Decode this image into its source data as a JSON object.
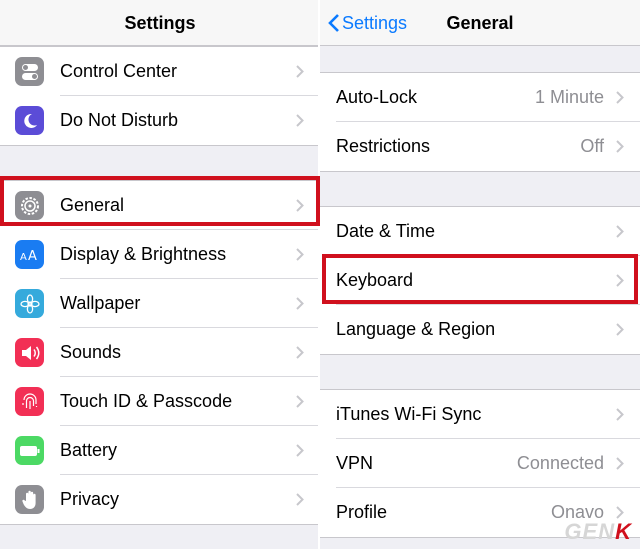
{
  "left": {
    "title": "Settings",
    "group1": [
      {
        "label": "Control Center",
        "icon": "control-center-icon",
        "color": "#8e8e93"
      },
      {
        "label": "Do Not Disturb",
        "icon": "moon-icon",
        "color": "#5b4cd7"
      }
    ],
    "group2": [
      {
        "label": "General",
        "icon": "gear-icon",
        "color": "#8e8e93"
      },
      {
        "label": "Display & Brightness",
        "icon": "text-size-icon",
        "color": "#1a7cf2"
      },
      {
        "label": "Wallpaper",
        "icon": "flower-icon",
        "color": "#35aadc"
      },
      {
        "label": "Sounds",
        "icon": "speaker-icon",
        "color": "#f22f55"
      },
      {
        "label": "Touch ID & Passcode",
        "icon": "fingerprint-icon",
        "color": "#f22f55"
      },
      {
        "label": "Battery",
        "icon": "battery-icon",
        "color": "#4cd964"
      },
      {
        "label": "Privacy",
        "icon": "hand-icon",
        "color": "#8e8e93"
      }
    ]
  },
  "right": {
    "back_label": "Settings",
    "title": "General",
    "group1": [
      {
        "label": "Auto-Lock",
        "value": "1 Minute"
      },
      {
        "label": "Restrictions",
        "value": "Off"
      }
    ],
    "group2": [
      {
        "label": "Date & Time",
        "value": ""
      },
      {
        "label": "Keyboard",
        "value": ""
      },
      {
        "label": "Language & Region",
        "value": ""
      }
    ],
    "group3": [
      {
        "label": "iTunes Wi-Fi Sync",
        "value": ""
      },
      {
        "label": "VPN",
        "value": "Connected"
      },
      {
        "label": "Profile",
        "value": "Onavo"
      }
    ]
  },
  "watermark": {
    "prefix": "GEN",
    "suffix": "K"
  },
  "colors": {
    "accent": "#0a7aff",
    "highlight": "#d0101d"
  }
}
